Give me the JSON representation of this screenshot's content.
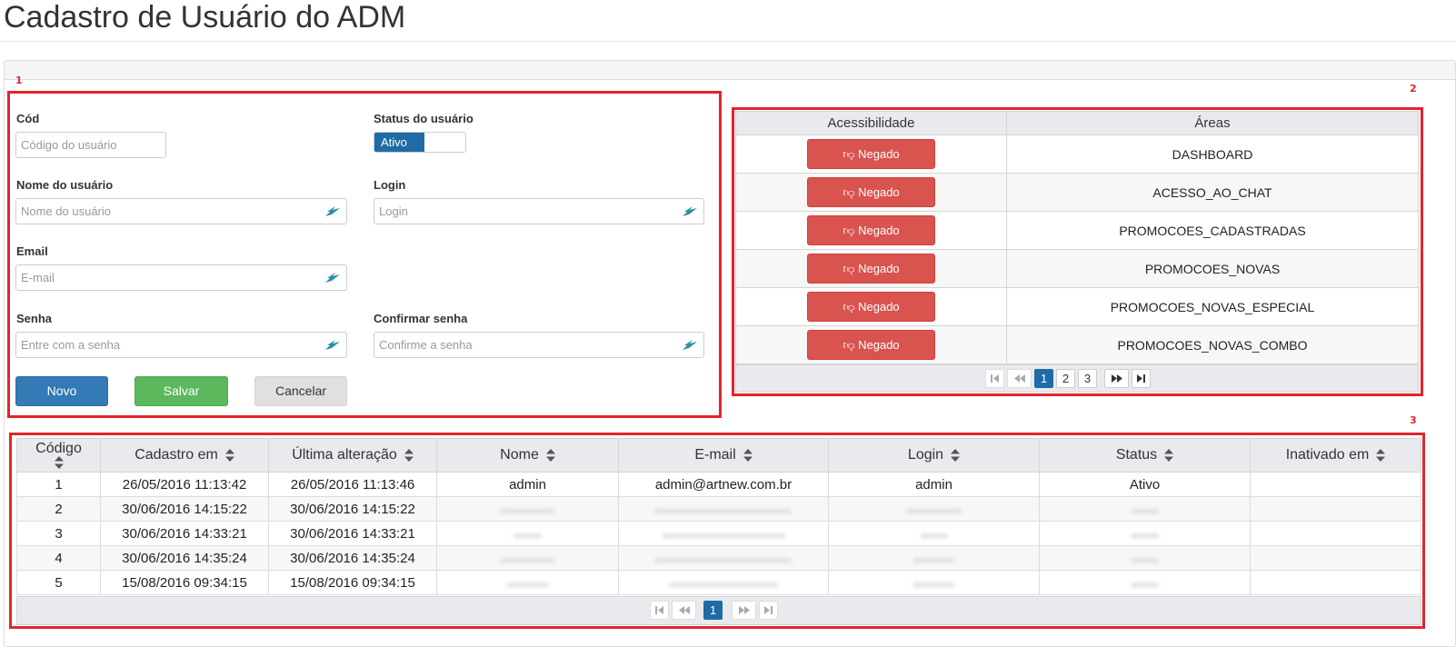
{
  "page": {
    "title": "Cadastro de Usuário do ADM"
  },
  "annotations": [
    "1",
    "2",
    "3"
  ],
  "form": {
    "cod_label": "Cód",
    "cod_placeholder": "Código do usuário",
    "status_label": "Status do usuário",
    "status_value": "Ativo",
    "nome_label": "Nome do usuário",
    "nome_placeholder": "Nome do usuário",
    "login_label": "Login",
    "login_placeholder": "Login",
    "email_label": "Email",
    "email_placeholder": "E-mail",
    "senha_label": "Senha",
    "senha_placeholder": "Entre com a senha",
    "confirmar_label": "Confirmar senha",
    "confirmar_placeholder": "Confirme a senha",
    "btn_novo": "Novo",
    "btn_salvar": "Salvar",
    "btn_cancelar": "Cancelar"
  },
  "access": {
    "headers": [
      "Acessibilidade",
      "Áreas"
    ],
    "rows": [
      {
        "button": "Negado",
        "area": "DASHBOARD"
      },
      {
        "button": "Negado",
        "area": "ACESSO_AO_CHAT"
      },
      {
        "button": "Negado",
        "area": "PROMOCOES_CADASTRADAS"
      },
      {
        "button": "Negado",
        "area": "PROMOCOES_NOVAS"
      },
      {
        "button": "Negado",
        "area": "PROMOCOES_NOVAS_ESPECIAL"
      },
      {
        "button": "Negado",
        "area": "PROMOCOES_NOVAS_COMBO"
      }
    ],
    "pages": [
      "1",
      "2",
      "3"
    ],
    "active_page": "1"
  },
  "users": {
    "headers": [
      "Código",
      "Cadastro em",
      "Última alteração",
      "Nome",
      "E-mail",
      "Login",
      "Status",
      "Inativado em"
    ],
    "rows": [
      {
        "codigo": "1",
        "cadastro": "26/05/2016 11:13:42",
        "alteracao": "26/05/2016 11:13:46",
        "nome": "admin",
        "email": "admin@artnew.com.br",
        "login": "admin",
        "status": "Ativo",
        "inativado": ""
      },
      {
        "codigo": "2",
        "cadastro": "30/06/2016 14:15:22",
        "alteracao": "30/06/2016 14:15:22",
        "nome": "",
        "email": "",
        "login": "",
        "status": "",
        "inativado": ""
      },
      {
        "codigo": "3",
        "cadastro": "30/06/2016 14:33:21",
        "alteracao": "30/06/2016 14:33:21",
        "nome": "",
        "email": "",
        "login": "",
        "status": "",
        "inativado": ""
      },
      {
        "codigo": "4",
        "cadastro": "30/06/2016 14:35:24",
        "alteracao": "30/06/2016 14:35:24",
        "nome": "",
        "email": "",
        "login": "",
        "status": "",
        "inativado": ""
      },
      {
        "codigo": "5",
        "cadastro": "15/08/2016 09:34:15",
        "alteracao": "15/08/2016 09:34:15",
        "nome": "",
        "email": "",
        "login": "",
        "status": "",
        "inativado": ""
      }
    ],
    "pages": [
      "1"
    ],
    "active_page": "1"
  },
  "colors": {
    "annotation": "#e3242b",
    "primary": "#337ab7",
    "success": "#5cb85c",
    "danger": "#d9534f",
    "active_page": "#1f6ba5"
  }
}
